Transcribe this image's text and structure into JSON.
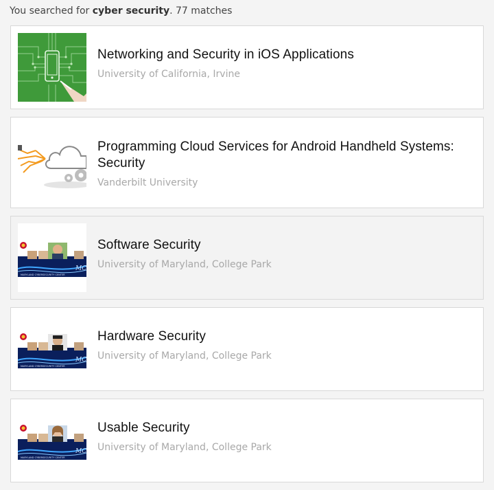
{
  "search": {
    "prefix": "You searched for",
    "query": "cyber security",
    "suffix": ". 77 matches"
  },
  "results": [
    {
      "title": "Networking and Security in iOS Applications",
      "partner": "University of California, Irvine",
      "image": "circuit-phone-image"
    },
    {
      "title": "Programming Cloud Services for Android Handheld Systems: Security",
      "partner": "Vanderbilt University",
      "image": "cloud-gears-image"
    },
    {
      "title": "Software Security",
      "partner": "University of Maryland, College Park",
      "image": "maryland-cybersecurity-center-image"
    },
    {
      "title": "Hardware Security",
      "partner": "University of Maryland, College Park",
      "image": "maryland-cybersecurity-center-image"
    },
    {
      "title": "Usable Security",
      "partner": "University of Maryland, College Park",
      "image": "maryland-cybersecurity-center-image"
    }
  ],
  "thumb_text": {
    "mc2": "MC2",
    "center": "MARYLAND CYBERSECURITY CENTER"
  },
  "colors": {
    "circuit_green": "#3f9a3a",
    "cloud_orange": "#f39a1e",
    "maryland_blue": "#0a1f5c",
    "partner_text": "#a8a8a8"
  }
}
